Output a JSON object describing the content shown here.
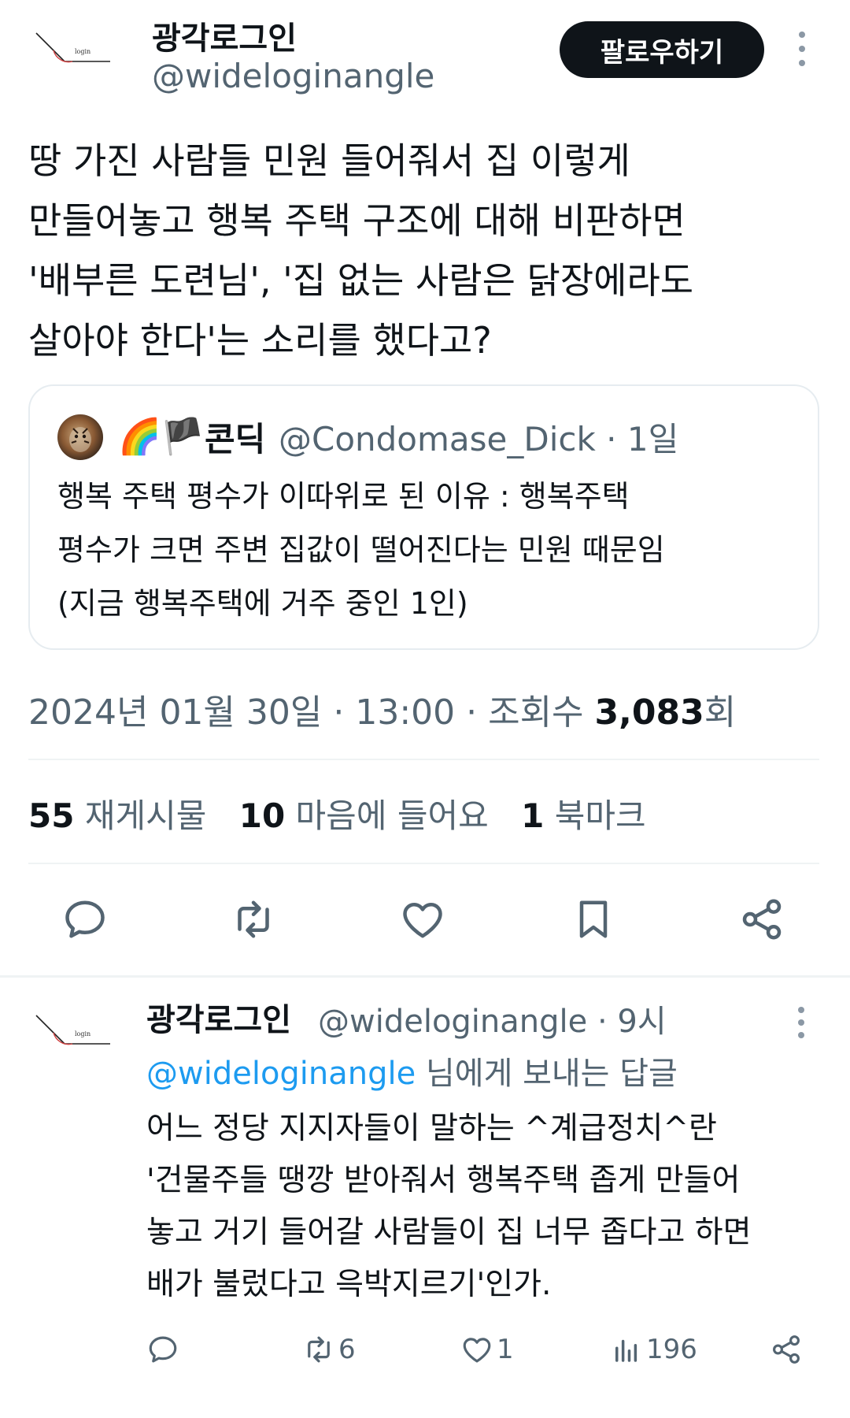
{
  "tweet": {
    "author_name": "광각로그인",
    "author_handle": "@wideloginangle",
    "logo_text": "login",
    "follow_label": "팔로우하기",
    "text_lines": [
      "땅 가진 사람들 민원 들어줘서 집 이렇게",
      "만들어놓고 행복 주택 구조에 대해 비판하면",
      "'배부른 도련님', '집 없는 사람은 닭장에라도",
      "살아야 한다'는 소리를 했다고?"
    ]
  },
  "quote": {
    "emojis": "🌈🏴",
    "name": "콘딕",
    "handle_time": "@Condomase_Dick · 1일",
    "text_lines": [
      "행복 주택 평수가 이따위로 된 이유 : 행복주택",
      "평수가 크면 주변 집값이 떨어진다는 민원 때문임",
      "(지금 행복주택에 거주 중인 1인)"
    ]
  },
  "meta": {
    "timestamp": "2024년 01월 30일 · 13:00 · 조회수 ",
    "views": "3,083",
    "views_suffix": "회"
  },
  "stats": {
    "reposts_count": "55",
    "reposts_label": "재게시물",
    "likes_count": "10",
    "likes_label": "마음에 들어요",
    "bookmarks_count": "1",
    "bookmarks_label": "북마크"
  },
  "icons": {
    "actions": [
      "reply-icon",
      "repost-icon",
      "like-icon",
      "bookmark-icon",
      "share-icon"
    ],
    "more": "more-vertical-icon"
  },
  "reply": {
    "author_name": "광각로그인",
    "handle_time": "@wideloginangle · 9시",
    "reply_to_mention": "@wideloginangle",
    "reply_to_suffix": " 님에게 보내는 답글",
    "text_lines": [
      "어느 정당 지지자들이 말하는 ^계급정치^란",
      "'건물주들 땡깡 받아줘서 행복주택 좁게 만들어",
      "놓고 거기 들어갈 사람들이 집 너무 좁다고 하면",
      "배가 불렀다고 윽박지르기'인가."
    ],
    "reposts": "6",
    "likes": "1",
    "views": "196"
  },
  "colors": {
    "text_primary": "#0f1419",
    "text_secondary": "#536471",
    "link": "#1d9bf0",
    "follow_bg": "#0f1419",
    "border": "#e6ecf0"
  }
}
